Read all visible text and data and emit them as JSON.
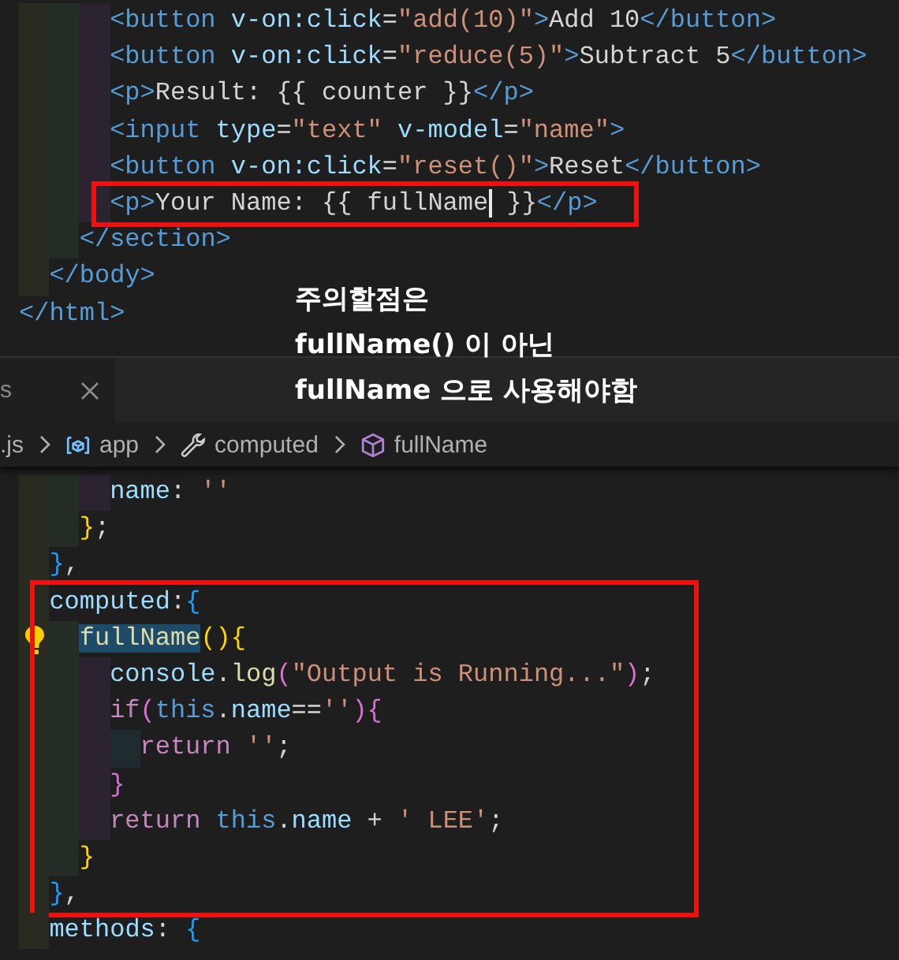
{
  "editor_top": {
    "children": [
      {
        "children": [
          {
            "children": [
              {
                "children": [
                  {
                    "tokens": [
                      {
                        "kind": "tag",
                        "text": "<button"
                      },
                      {
                        "kind": "attr",
                        "text": " v-on:click"
                      },
                      {
                        "kind": "text",
                        "text": "="
                      },
                      {
                        "kind": "str",
                        "text": "\"add(10)\""
                      },
                      {
                        "kind": "tag",
                        "text": ">"
                      },
                      {
                        "kind": "text",
                        "text": "Add 10"
                      },
                      {
                        "kind": "tag",
                        "text": "</button>"
                      }
                    ]
                  },
                  {
                    "tokens": [
                      {
                        "kind": "tag",
                        "text": "<button"
                      },
                      {
                        "kind": "attr",
                        "text": " v-on:click"
                      },
                      {
                        "kind": "text",
                        "text": "="
                      },
                      {
                        "kind": "str",
                        "text": "\"reduce(5)\""
                      },
                      {
                        "kind": "tag",
                        "text": ">"
                      },
                      {
                        "kind": "text",
                        "text": "Subtract 5"
                      },
                      {
                        "kind": "tag",
                        "text": "</button>"
                      }
                    ]
                  },
                  {
                    "tokens": [
                      {
                        "kind": "tag",
                        "text": "<p>"
                      },
                      {
                        "kind": "text",
                        "text": "Result: {{ counter }}"
                      },
                      {
                        "kind": "tag",
                        "text": "</p>"
                      }
                    ]
                  },
                  {
                    "tokens": [
                      {
                        "kind": "tag",
                        "text": "<input"
                      },
                      {
                        "kind": "attr",
                        "text": " type"
                      },
                      {
                        "kind": "text",
                        "text": "="
                      },
                      {
                        "kind": "str",
                        "text": "\"text\""
                      },
                      {
                        "kind": "attr",
                        "text": " v-model"
                      },
                      {
                        "kind": "text",
                        "text": "="
                      },
                      {
                        "kind": "str",
                        "text": "\"name\""
                      },
                      {
                        "kind": "tag",
                        "text": ">"
                      }
                    ]
                  },
                  {
                    "tokens": [
                      {
                        "kind": "tag",
                        "text": "<button"
                      },
                      {
                        "kind": "attr",
                        "text": " v-on:click"
                      },
                      {
                        "kind": "text",
                        "text": "="
                      },
                      {
                        "kind": "str",
                        "text": "\"reset()\""
                      },
                      {
                        "kind": "tag",
                        "text": ">"
                      },
                      {
                        "kind": "text",
                        "text": "Reset"
                      },
                      {
                        "kind": "tag",
                        "text": "</button>"
                      }
                    ]
                  },
                  {
                    "kind": "box",
                    "children": [
                      {
                        "tokens": [
                          {
                            "kind": "tag",
                            "text": "<p>"
                          },
                          {
                            "kind": "text",
                            "text": "Your Name: {{ fullName",
                            "caret": true
                          },
                          {
                            "kind": "text",
                            "text": " }}"
                          },
                          {
                            "kind": "tag",
                            "text": "</p>"
                          }
                        ]
                      }
                    ]
                  }
                ]
              },
              {
                "tokens": [
                  {
                    "kind": "tag",
                    "text": "</section>"
                  }
                ]
              }
            ]
          },
          {
            "tokens": [
              {
                "kind": "tag",
                "text": "</body>"
              }
            ]
          }
        ]
      },
      {
        "tokens": [
          {
            "kind": "tag",
            "text": "</html>"
          }
        ]
      }
    ]
  },
  "tab": {
    "label": "s"
  },
  "breadcrumb": [
    {
      "kind": "file",
      "label": ".js"
    },
    {
      "kind": "variable",
      "label": "app"
    },
    {
      "kind": "property",
      "label": "computed"
    },
    {
      "kind": "method",
      "label": "fullName"
    }
  ],
  "editor_bottom": {
    "children": [
      {
        "children": [
          {
            "children": [
              {
                "children": [
                  {
                    "tokens": [
                      {
                        "kind": "var",
                        "text": "name"
                      },
                      {
                        "kind": "text",
                        "text": ": "
                      },
                      {
                        "kind": "str",
                        "text": "''"
                      }
                    ]
                  }
                ]
              },
              {
                "tokens": [
                  {
                    "kind": "brace1",
                    "text": "}"
                  },
                  {
                    "kind": "text",
                    "text": ";"
                  }
                ]
              }
            ]
          },
          {
            "tokens": [
              {
                "kind": "brace3",
                "text": "}"
              },
              {
                "kind": "text",
                "text": ","
              }
            ]
          },
          {
            "kind": "box",
            "children": [
              {
                "tokens": [
                  {
                    "kind": "var",
                    "text": "computed"
                  },
                  {
                    "kind": "text",
                    "text": ":"
                  },
                  {
                    "kind": "brace3",
                    "text": "{"
                  }
                ]
              },
              {
                "children": [
                  {
                    "lightbulb": true,
                    "tokens": [
                      {
                        "kind": "func",
                        "text": "fullName",
                        "highlighted": true
                      },
                      {
                        "kind": "brace1",
                        "text": "(){"
                      }
                    ]
                  },
                  {
                    "children": [
                      {
                        "tokens": [
                          {
                            "kind": "var",
                            "text": "console"
                          },
                          {
                            "kind": "text",
                            "text": "."
                          },
                          {
                            "kind": "func",
                            "text": "log"
                          },
                          {
                            "kind": "brace2",
                            "text": "("
                          },
                          {
                            "kind": "str",
                            "text": "\"Output is Running...\""
                          },
                          {
                            "kind": "brace2",
                            "text": ")"
                          },
                          {
                            "kind": "text",
                            "text": ";"
                          }
                        ]
                      },
                      {
                        "tokens": [
                          {
                            "kind": "keyword",
                            "text": "if"
                          },
                          {
                            "kind": "brace2",
                            "text": "("
                          },
                          {
                            "kind": "builtin",
                            "text": "this"
                          },
                          {
                            "kind": "text",
                            "text": "."
                          },
                          {
                            "kind": "var",
                            "text": "name"
                          },
                          {
                            "kind": "text",
                            "text": "=="
                          },
                          {
                            "kind": "str",
                            "text": "''"
                          },
                          {
                            "kind": "brace2",
                            "text": "){"
                          }
                        ]
                      },
                      {
                        "children": [
                          {
                            "tokens": [
                              {
                                "kind": "keyword",
                                "text": "return "
                              },
                              {
                                "kind": "str",
                                "text": "''"
                              },
                              {
                                "kind": "text",
                                "text": ";"
                              }
                            ]
                          }
                        ]
                      },
                      {
                        "tokens": [
                          {
                            "kind": "brace2",
                            "text": "}"
                          }
                        ]
                      },
                      {
                        "tokens": [
                          {
                            "kind": "keyword",
                            "text": "return "
                          },
                          {
                            "kind": "builtin",
                            "text": "this"
                          },
                          {
                            "kind": "text",
                            "text": "."
                          },
                          {
                            "kind": "var",
                            "text": "name"
                          },
                          {
                            "kind": "text",
                            "text": " + "
                          },
                          {
                            "kind": "str",
                            "text": "' LEE'"
                          },
                          {
                            "kind": "text",
                            "text": ";"
                          }
                        ]
                      }
                    ]
                  },
                  {
                    "tokens": [
                      {
                        "kind": "brace1",
                        "text": "}"
                      }
                    ]
                  }
                ]
              },
              {
                "tokens": [
                  {
                    "kind": "brace3",
                    "text": "}"
                  },
                  {
                    "kind": "text",
                    "text": ","
                  }
                ]
              }
            ]
          },
          {
            "tokens": [
              {
                "kind": "var",
                "text": "methods"
              },
              {
                "kind": "text",
                "text": ": "
              },
              {
                "kind": "brace3",
                "text": "{"
              }
            ]
          }
        ]
      }
    ]
  },
  "annotation": {
    "lines": [
      "주의할점은",
      "fullName() 이 아닌",
      "fullName 으로 사용해야함"
    ]
  }
}
